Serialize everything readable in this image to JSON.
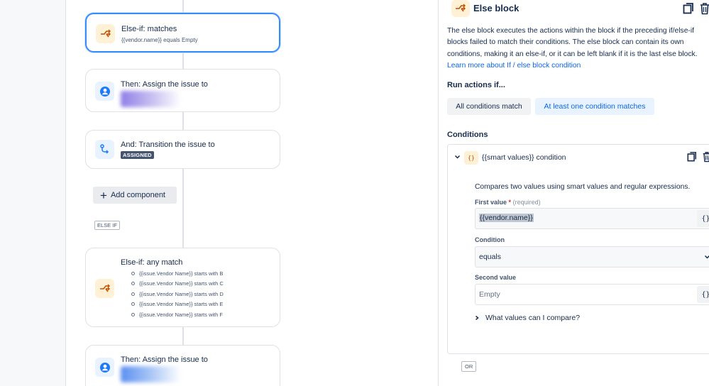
{
  "canvas": {
    "cards": [
      {
        "title": "Else-if: matches",
        "sub": "{{vendor.name}} equals Empty",
        "icon": "branch-icon"
      },
      {
        "title": "Then: Assign the issue to",
        "icon": "user-icon"
      },
      {
        "title": "And: Transition the issue to",
        "lozenge": "ASSIGNED",
        "icon": "transition-icon"
      },
      {
        "title": "Else-if: any match",
        "icon": "branch-icon",
        "conditions": [
          "{{issue.Vendor Name}} starts with B",
          "{{issue.Vendor Name}} starts with C",
          "{{issue.Vendor Name}} starts with D",
          "{{issue.Vendor Name}} starts with E",
          "{{issue.Vendor Name}} starts with F"
        ]
      },
      {
        "title": "Then: Assign the issue to",
        "icon": "user-icon"
      }
    ],
    "add_component": "Add component",
    "else_if_tag": "ELSE IF"
  },
  "panel": {
    "title": "Else block",
    "description": "The else block executes the actions within the block if the preceding if/else-if blocks failed to match their conditions. The else block can contain its own conditions, making it an else-if, or it can be left blank if it is the last else block.",
    "learn_more": "Learn more about If / else block condition",
    "run_actions_label": "Run actions if...",
    "run_options": [
      "All conditions match",
      "At least one condition matches"
    ],
    "selected_option": "At least one condition matches",
    "conditions_label": "Conditions",
    "condition": {
      "badge": "{}",
      "title": "{{smart values}} condition",
      "description": "Compares two values using smart values and regular expressions.",
      "first_value_label": "First value",
      "required_mark": "*",
      "required_hint": "(required)",
      "first_value": "{{vendor.name}}",
      "condition_label": "Condition",
      "condition_value": "equals",
      "second_value_label": "Second value",
      "second_value_placeholder": "Empty",
      "brace_button": "{}",
      "what_values": "What values can I compare?"
    },
    "or_tag": "OR"
  },
  "colors": {
    "accent": "#0c66e4",
    "selected_border": "#388bff",
    "orange_icon": "#c25100",
    "blue_icon": "#1d7afc"
  }
}
